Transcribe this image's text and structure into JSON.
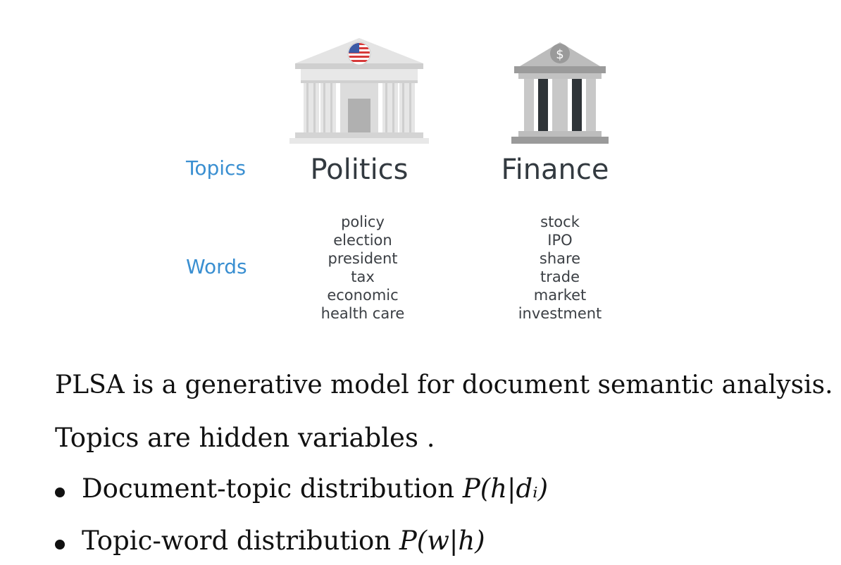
{
  "labels": {
    "topics": "Topics",
    "words": "Words"
  },
  "topics": [
    {
      "name": "Politics",
      "icon": "government-building-flag-icon",
      "words": [
        "policy",
        "election",
        "president",
        "tax",
        "economic",
        "health care"
      ]
    },
    {
      "name": "Finance",
      "icon": "bank-building-dollar-icon",
      "words": [
        "stock",
        "IPO",
        "share",
        "trade",
        "market",
        "investment"
      ]
    }
  ],
  "text": {
    "line1": "PLSA is a generative model for document semantic analysis.",
    "line2": "Topics are hidden variables .",
    "bullets": [
      {
        "text": "Document-topic distribution",
        "formula": "P(h|dᵢ)"
      },
      {
        "text": "Topic-word distribution",
        "formula": "P(w|h)"
      }
    ]
  },
  "colors": {
    "label_blue": "#3a8fd1",
    "title_dark": "#333a40",
    "building_light": "#d8d8d8",
    "building_dark": "#2f3438"
  }
}
